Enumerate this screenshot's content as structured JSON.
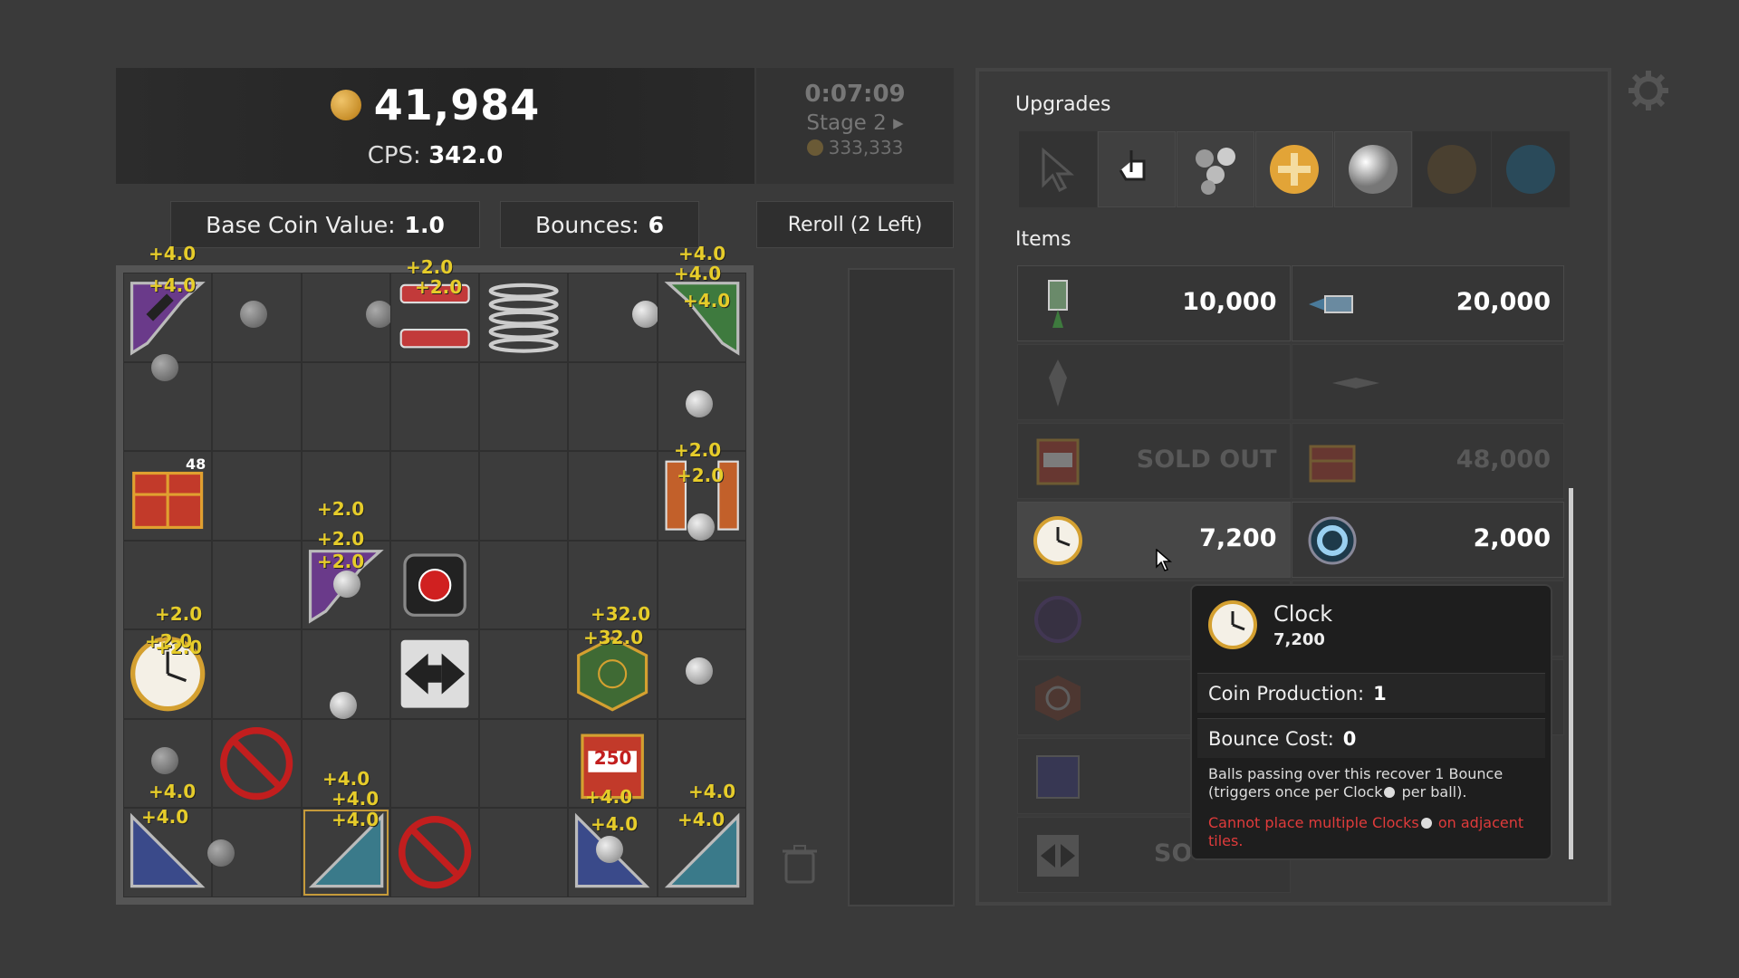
{
  "header": {
    "coins": "41,984",
    "cps_label": "CPS:",
    "cps_value": "342.0"
  },
  "stage_info": {
    "timer": "0:07:09",
    "stage": "Stage  2 ▸",
    "next_cost": "333,333"
  },
  "stats": {
    "base_label": "Base Coin Value:",
    "base_value": "1.0",
    "bounces_label": "Bounces:",
    "bounces_value": "6",
    "reroll_label": "Reroll (2 Left)"
  },
  "board": {
    "chest_count": "48",
    "slot_value": "250",
    "floats": [
      "+4.0",
      "+4.0",
      "+2.0",
      "+2.0",
      "+4.0",
      "+4.0",
      "+4.0",
      "+2.0",
      "+2.0",
      "+2.0",
      "+2.0",
      "+2.0",
      "+2.0",
      "+2.0",
      "+2.0",
      "+32.0",
      "+32.0",
      "+4.0",
      "+4.0",
      "+4.0",
      "+4.0",
      "+4.0",
      "+4.0",
      "+4.0",
      "+4.0",
      "+4.0"
    ]
  },
  "shop": {
    "upgrades_title": "Upgrades",
    "upgrades": [
      "cursor-icon",
      "hand-pointer-icon",
      "multi-ball-icon",
      "plus-coin-icon",
      "steel-ball-icon",
      "bronze-ball-icon",
      "blue-ball-icon"
    ],
    "items_title": "Items",
    "items": [
      {
        "icon": "green-launcher-icon",
        "price": "10,000"
      },
      {
        "icon": "blue-cannon-icon",
        "price": "20,000"
      },
      {
        "icon": "vertical-launcher-icon",
        "price": ""
      },
      {
        "icon": "horizontal-launcher-icon",
        "price": ""
      },
      {
        "icon": "slot-machine-icon",
        "price": "SOLD OUT"
      },
      {
        "icon": "red-chest-icon",
        "price": "48,000"
      },
      {
        "icon": "clock-icon",
        "price": "7,200"
      },
      {
        "icon": "portal-ring-icon",
        "price": "2,000"
      },
      {
        "icon": "purple-ring-icon",
        "price": ""
      },
      {
        "icon": "target-shield-icon",
        "price": ""
      },
      {
        "icon": "purple-square-icon",
        "price": ""
      },
      {
        "icon": "arrow-swap-icon",
        "price": "SO"
      }
    ]
  },
  "tooltip": {
    "name": "Clock",
    "cost": "7,200",
    "production_label": "Coin Production:",
    "production_value": "1",
    "bounce_cost_label": "Bounce Cost:",
    "bounce_cost_value": "0",
    "desc_1": "Balls passing over this recover 1 Bounce",
    "desc_2": "(triggers once per Clock",
    "desc_3": " per ball).",
    "warn_1": "Cannot place multiple Clocks",
    "warn_2": " on adjacent tiles."
  },
  "colors": {
    "coin_gold": "#c88f2a",
    "float_yellow": "#e6cc2a",
    "warning_red": "#e03b3b"
  }
}
